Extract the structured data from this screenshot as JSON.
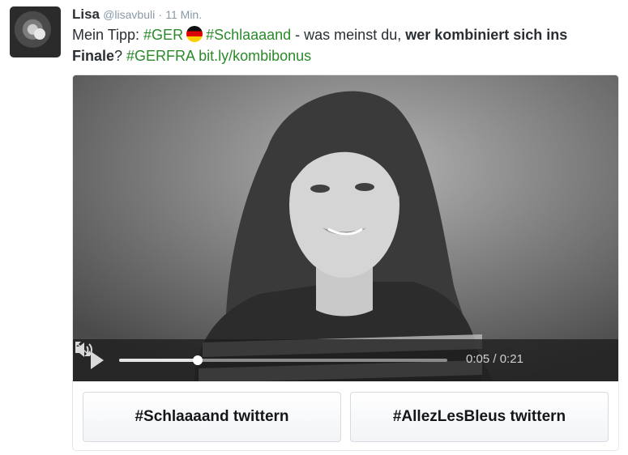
{
  "tweet": {
    "name": "Lisa",
    "handle": "@lisavbuli",
    "separator": "·",
    "time": "11 Min.",
    "text_part1": "Mein Tipp: ",
    "tag1": "#GER",
    "flag_icon": "germany-flag-icon",
    "tag2": "#Schlaaaand",
    "text_part2": " - was meinst du, ",
    "bold_text": "wer kombiniert sich ins Finale",
    "text_part3": "? ",
    "tag3": "#GERFRA",
    "link": "bit.ly/kombibonus",
    "hashtag_color": "#2a8a2a"
  },
  "video": {
    "current_time": "0:05",
    "time_separator": "/",
    "duration": "0:21",
    "progress_fraction": 0.24,
    "play_icon": "play-icon",
    "volume_icon": "volume-icon",
    "fullscreen_icon": "fullscreen-icon"
  },
  "buttons": {
    "left_label": "#Schlaaaand twittern",
    "right_label": "#AllezLesBleus twittern"
  }
}
